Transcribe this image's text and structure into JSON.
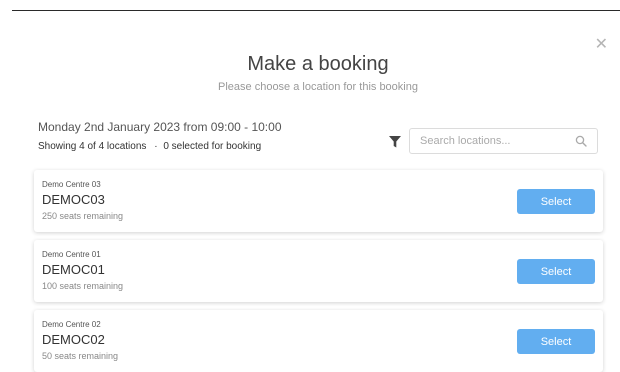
{
  "modal": {
    "close_glyph": "✕",
    "title": "Make a booking",
    "subtitle": "Please choose a location for this booking"
  },
  "summary": {
    "date_text": "Monday 2nd January 2023 from 09:00 - 10:00",
    "showing_text": "Showing 4 of 4 locations",
    "separator": "·",
    "selected_text": "0 selected for booking"
  },
  "search": {
    "placeholder": "Search locations...",
    "value": "",
    "icon": "search-icon",
    "filter_icon": "filter-icon"
  },
  "locations": [
    {
      "centre": "Demo Centre 03",
      "code": "DEMOC03",
      "seats": "250 seats remaining",
      "button_label": "Select"
    },
    {
      "centre": "Demo Centre 01",
      "code": "DEMOC01",
      "seats": "100 seats remaining",
      "button_label": "Select"
    },
    {
      "centre": "Demo Centre 02",
      "code": "DEMOC02",
      "seats": "50 seats remaining",
      "button_label": "Select"
    }
  ],
  "colors": {
    "accent": "#62aef0",
    "muted_text": "#999999"
  }
}
